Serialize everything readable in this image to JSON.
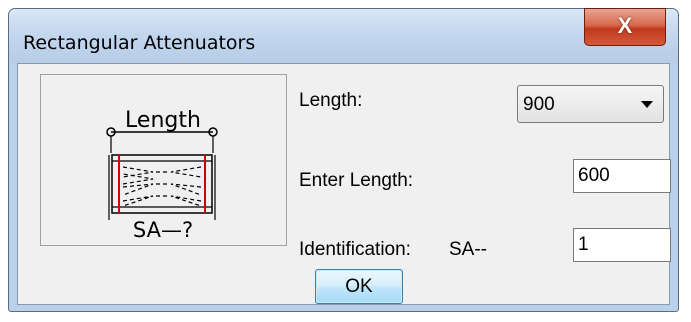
{
  "window": {
    "title": "Rectangular Attenuators",
    "close_glyph": "X"
  },
  "preview": {
    "top_label": "Length",
    "bottom_label": "SA—?"
  },
  "length": {
    "label": "Length:",
    "selected": "900"
  },
  "enter_length": {
    "label": "Enter Length:",
    "value": "600"
  },
  "identification": {
    "label": "Identification:",
    "prefix": "SA--",
    "value": "1"
  },
  "ok_label": "OK",
  "colors": {
    "attenuator_edge": "#d40000"
  }
}
